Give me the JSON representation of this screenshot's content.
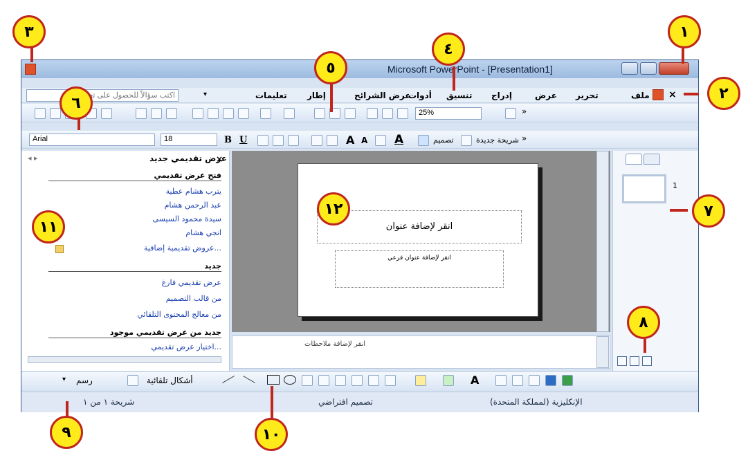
{
  "window": {
    "title": "Microsoft PowerPoint - [Presentation1]"
  },
  "menu": {
    "items": [
      "ملف",
      "تحرير",
      "عرض",
      "إدراج",
      "تنسيق",
      "أدوات",
      "عرض الشرائح",
      "إطار",
      "تعليمات"
    ],
    "help_box": "اكتب سؤالاً للحصول على تعليمات"
  },
  "toolbar": {
    "zoom": "25%",
    "font": "Arial",
    "size": "18",
    "new_slide": "شريحة جديدة",
    "design": "تصميم"
  },
  "task_pane": {
    "title": "عرض تقديمي جديد",
    "section_open": "فتح عرض تقديمي",
    "recent": [
      "يترب هشام عطية",
      "عبد الرحمن هشام",
      "سيدة محمود السيسى",
      "انجي هشام"
    ],
    "more": "عروض تقديمية إضافية...",
    "section_new": "جديد",
    "new_items": [
      "عرض تقديمي فارغ",
      "من قالب التصميم",
      "من معالج المحتوى التلقائي"
    ],
    "section_existing": "جديد من عرض تقديمي موجود",
    "choose": "اختيار عرض تقديمي..."
  },
  "slide": {
    "title_placeholder": "انقر لإضافة عنوان",
    "subtitle_placeholder": "انقر لإضافة عنوان فرعي",
    "notes_placeholder": "انقر لإضافة ملاحظات"
  },
  "thumbs": {
    "slide_number": "1"
  },
  "draw": {
    "draw_label": "رسم",
    "autoshapes_label": "أشكال تلقائية"
  },
  "status": {
    "slide_count": "شريحة ١ من ١",
    "design": "تصميم افتراضي",
    "language": "الإنكليزية (لمملكة المتحدة)"
  },
  "callouts": [
    "١",
    "٢",
    "٣",
    "٤",
    "٥",
    "٦",
    "٧",
    "٨",
    "٩",
    "١٠",
    "١١",
    "١٢"
  ],
  "colors": {
    "callout_fill": "#ffea1a",
    "callout_border": "#c0261c",
    "title_bar": "#9dbbe0"
  }
}
